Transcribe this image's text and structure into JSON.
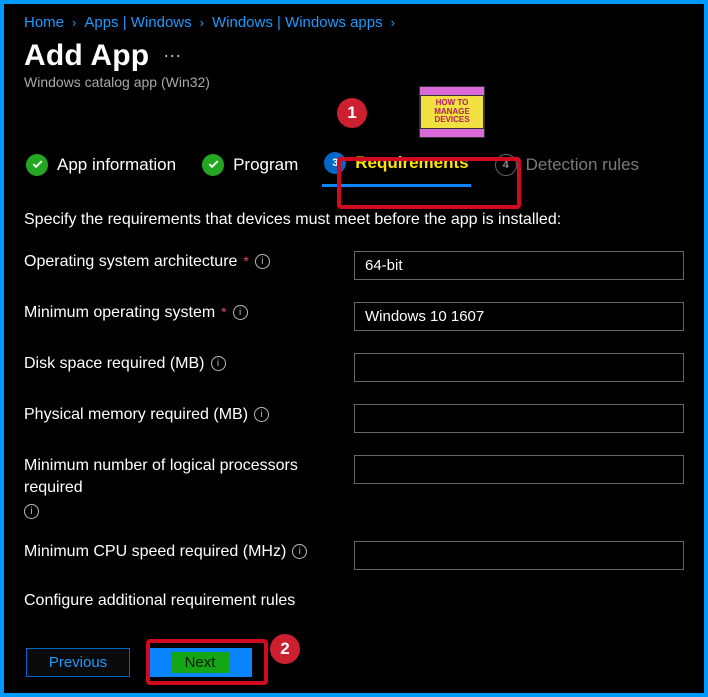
{
  "breadcrumb": {
    "items": [
      "Home",
      "Apps | Windows",
      "Windows | Windows apps"
    ]
  },
  "header": {
    "title": "Add App",
    "subtitle": "Windows catalog app (Win32)",
    "more": "···"
  },
  "logo": {
    "text": "HOW TO\nMANAGE\nDEVICES"
  },
  "steps": {
    "s1": "App information",
    "s2": "Program",
    "s3": "Requirements",
    "s4": "Detection rules",
    "n3": "3",
    "n4": "4"
  },
  "instruction": "Specify the requirements that devices must meet before the app is installed:",
  "form": {
    "os_arch": {
      "label": "Operating system architecture",
      "value": "64-bit"
    },
    "min_os": {
      "label": "Minimum operating system",
      "value": "Windows 10 1607"
    },
    "disk": {
      "label": "Disk space required (MB)",
      "value": ""
    },
    "mem": {
      "label": "Physical memory required (MB)",
      "value": ""
    },
    "cores": {
      "label": "Minimum number of logical processors required",
      "value": ""
    },
    "cpu": {
      "label": "Minimum CPU speed required (MHz)",
      "value": ""
    },
    "extra": "Configure additional requirement rules"
  },
  "buttons": {
    "previous": "Previous",
    "next": "Next"
  },
  "annot": {
    "one": "1",
    "two": "2"
  }
}
